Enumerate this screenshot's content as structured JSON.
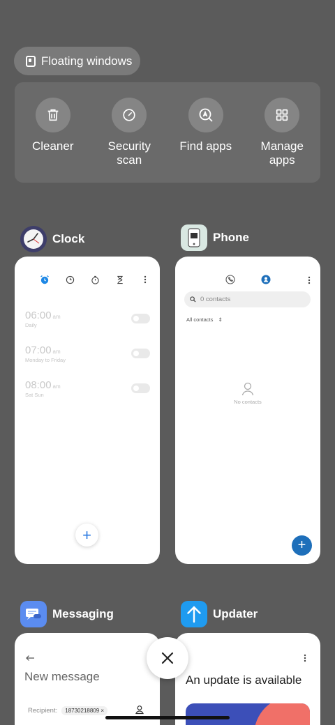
{
  "floating_windows": {
    "label": "Floating windows"
  },
  "quick_actions": [
    {
      "label": "Cleaner",
      "icon": "trash-icon"
    },
    {
      "label": "Security\nscan",
      "icon": "security-scan-icon"
    },
    {
      "label": "Find apps",
      "icon": "find-apps-icon"
    },
    {
      "label": "Manage\napps",
      "icon": "manage-apps-icon"
    }
  ],
  "apps": {
    "clock": {
      "title": "Clock",
      "alarms": [
        {
          "time": "06:00",
          "ampm": "am",
          "repeat": "Daily"
        },
        {
          "time": "07:00",
          "ampm": "am",
          "repeat": "Monday to Friday"
        },
        {
          "time": "08:00",
          "ampm": "am",
          "repeat": "Sat Sun"
        }
      ]
    },
    "phone": {
      "title": "Phone",
      "search_placeholder": "0 contacts",
      "filter": "All contacts",
      "empty_text": "No contacts"
    },
    "messaging": {
      "title": "Messaging",
      "screen_title": "New message",
      "recipient_label": "Recipient:",
      "recipient_chip": "18730218809 ×"
    },
    "updater": {
      "title": "Updater",
      "headline": "An update is available"
    }
  },
  "colors": {
    "background": "#5b5b5b",
    "accent": "#1e6fba"
  }
}
